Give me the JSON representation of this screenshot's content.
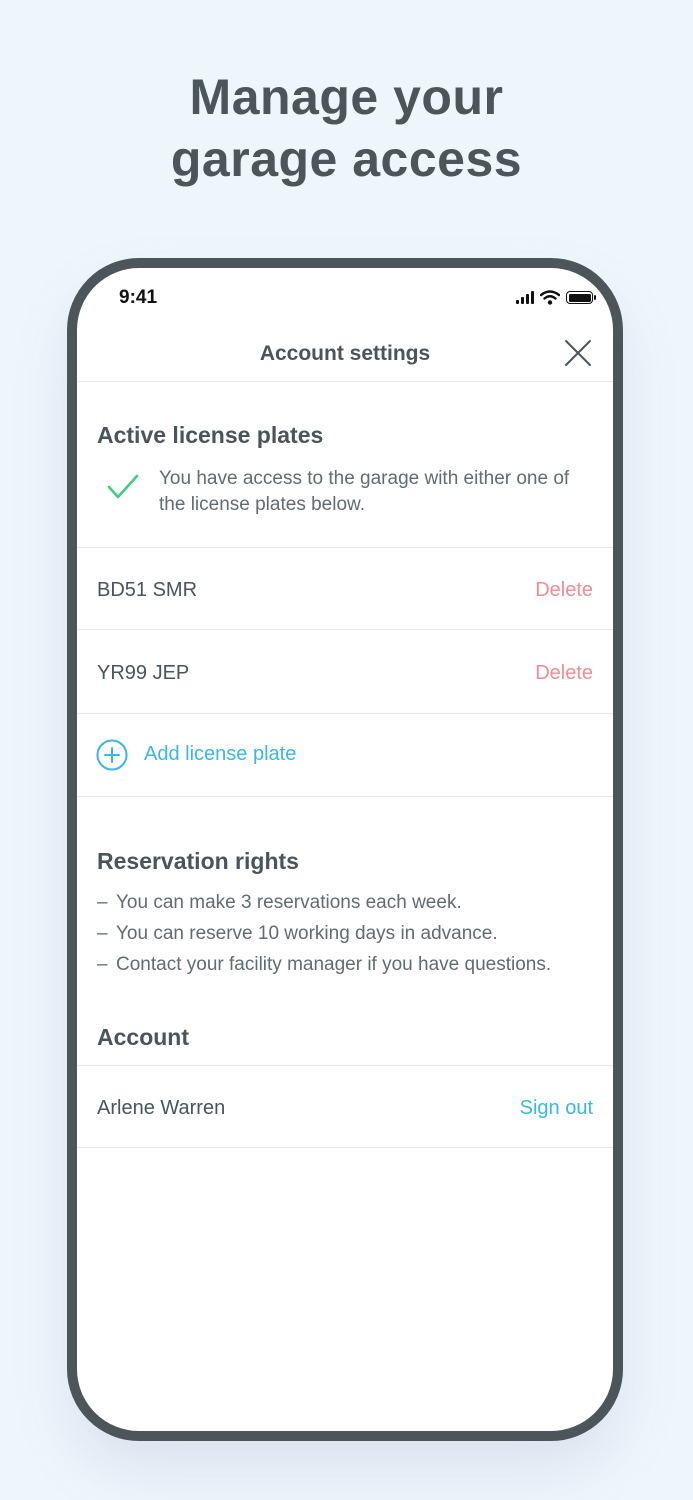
{
  "headline": {
    "line1": "Manage your",
    "line2": "garage access"
  },
  "status_bar": {
    "time": "9:41",
    "icons": [
      "cellular-signal-icon",
      "wifi-icon",
      "battery-icon"
    ]
  },
  "nav": {
    "title": "Account settings",
    "close_icon": "close-icon"
  },
  "license_plates": {
    "title": "Active license plates",
    "info": "You have access to the garage with either one of the license plates below.",
    "plates": [
      {
        "plate": "BD51 SMR",
        "action": "Delete"
      },
      {
        "plate": "YR99 JEP",
        "action": "Delete"
      }
    ],
    "add_label": "Add license plate"
  },
  "reservation": {
    "title": "Reservation rights",
    "items": [
      "You can make 3 reservations each week.",
      "You can reserve 10 working days in advance.",
      "Contact your facility manager if you have questions."
    ]
  },
  "account": {
    "title": "Account",
    "name": "Arlene Warren",
    "signout": "Sign out"
  },
  "colors": {
    "background": "#eef6fd",
    "accent": "#3ab7e6",
    "delete": "#f08c96",
    "check": "#3ecf7c",
    "phone_frame": "#4c5559"
  }
}
